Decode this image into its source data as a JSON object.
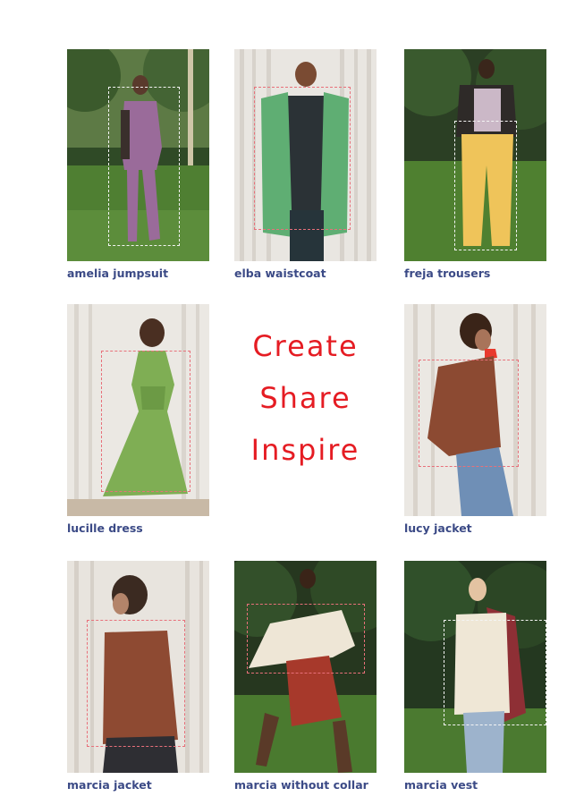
{
  "colors": {
    "label": "#3b4a86",
    "tagline": "#e51c23",
    "dash_white": "#f4f4f4",
    "dash_red": "#e8707a"
  },
  "tagline": [
    "Create",
    "Share",
    "Inspire"
  ],
  "items": [
    {
      "label": "amelia jumpsuit",
      "scene": "park",
      "garment_color": "#9a6b9a",
      "accent_color": "#3a2f2c",
      "dash": "white"
    },
    {
      "label": "elba waistcoat",
      "scene": "curtain",
      "garment_color": "#5fae73",
      "accent_color": "#2b3236",
      "dash": "red"
    },
    {
      "label": "freja trousers",
      "scene": "park",
      "garment_color": "#efc45a",
      "accent_color": "#2e2a28",
      "dash": "white"
    },
    {
      "label": "lucille dress",
      "scene": "curtain",
      "garment_color": "#7fae54",
      "accent_color": "#3b2a24",
      "dash": "red"
    },
    {
      "label": "lucy jacket",
      "scene": "curtain",
      "garment_color": "#8c4a32",
      "accent_color": "#6f8fb6",
      "dash": "red"
    },
    {
      "label": "marcia jacket",
      "scene": "curtain",
      "garment_color": "#8e4a32",
      "accent_color": "#2e2e33",
      "dash": "red"
    },
    {
      "label": "marcia without collar",
      "scene": "park",
      "garment_color": "#eee6d6",
      "accent_color": "#a7392b",
      "dash": "red"
    },
    {
      "label": "marcia vest",
      "scene": "park",
      "garment_color": "#efe7d6",
      "accent_color": "#8e2f35",
      "dash": "white"
    }
  ]
}
